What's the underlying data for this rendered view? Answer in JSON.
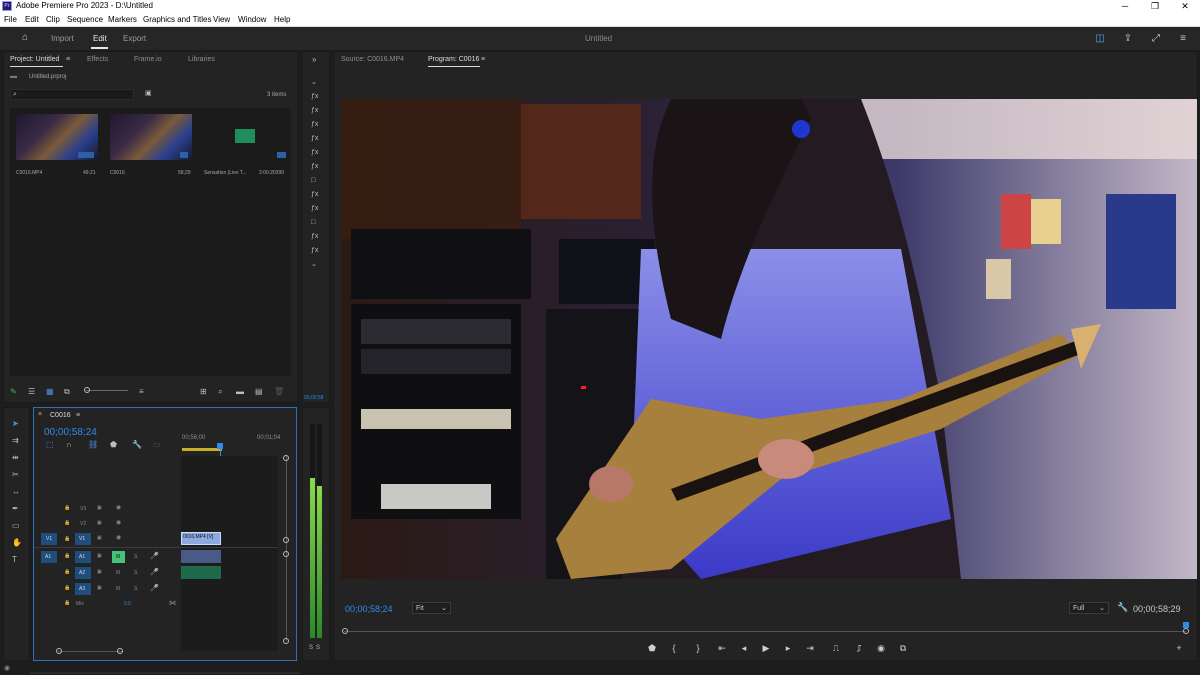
{
  "window": {
    "title": "Adobe Premiere Pro 2023 - D:\\Untitled",
    "app_icon": "Pr",
    "controls": [
      "minimize-icon",
      "maximize-icon",
      "close-icon"
    ]
  },
  "menu": [
    "File",
    "Edit",
    "Clip",
    "Sequence",
    "Markers",
    "Graphics and Titles",
    "View",
    "Window",
    "Help"
  ],
  "workspace": {
    "tabs": [
      "Import",
      "Edit",
      "Export"
    ],
    "active": "Edit",
    "document_title": "Untitled"
  },
  "project_panel": {
    "tabs": [
      "Project: Untitled",
      "Effects",
      "Frame.io",
      "Libraries"
    ],
    "file_name": "Untitled.prproj",
    "item_count": "3 items",
    "items": [
      {
        "name": "C0016.MP4",
        "duration": "49;21"
      },
      {
        "name": "C0016",
        "duration": "58;29"
      },
      {
        "name": "Sensation (Lies T...",
        "duration": "2:00:20390"
      }
    ]
  },
  "source_monitor": {
    "tab": "Source: C0016.MP4",
    "timecode": "00;00;58"
  },
  "program_monitor": {
    "tab": "Program: C0016",
    "timecode_in": "00;00;58;24",
    "fit": "Fit",
    "quality": "Full",
    "timecode_duration": "00;00;58;29"
  },
  "timeline": {
    "sequence_name": "C0016",
    "timecode": "00;00;58;24",
    "ruler": [
      "00;56;00",
      "00;01;04"
    ],
    "video_tracks": [
      "V3",
      "V2",
      "V1"
    ],
    "audio_tracks": [
      "A1",
      "A2",
      "A3"
    ],
    "source_patch_v": "V1",
    "source_patch_a": "A1",
    "mix_label": "Mix",
    "mix_value": "0.0",
    "clip_label": "0016.MP4 [V]",
    "mute_label": "M",
    "solo_label": "S"
  },
  "meter_labels": [
    "S",
    "S"
  ],
  "tools": [
    "selection-tool",
    "track-select-tool",
    "ripple-edit-tool",
    "razor-tool",
    "slip-tool",
    "pen-tool",
    "rectangle-tool",
    "hand-tool",
    "type-tool"
  ]
}
